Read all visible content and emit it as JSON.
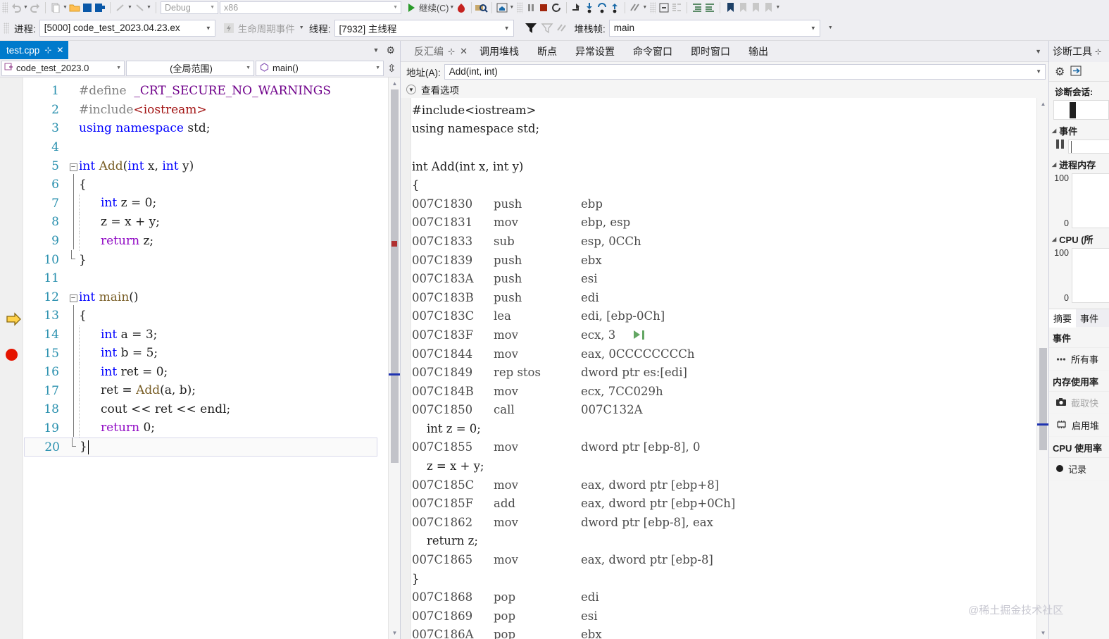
{
  "toolbar": {
    "config_combo": "Debug",
    "platform_combo": "x86",
    "continue_label": "继续(C)",
    "process_label": "进程:",
    "process_value": "[5000] code_test_2023.04.23.ex",
    "lifecycle_label": "生命周期事件",
    "thread_label": "线程:",
    "thread_value": "[7932] 主线程",
    "stackframe_label": "堆栈帧:",
    "stackframe_value": "main"
  },
  "editor": {
    "tab_label": "test.cpp",
    "project_combo": "code_test_2023.0",
    "scope_combo": "(全局范围)",
    "member_combo": "main()",
    "lines": [
      {
        "n": "1",
        "fold": "",
        "guide": false,
        "indent": 0,
        "tokens": [
          {
            "t": "#define",
            "c": "pp"
          },
          {
            "t": "  ",
            "c": "op"
          },
          {
            "t": "_CRT_SECURE_NO_WARNINGS",
            "c": "macro"
          }
        ]
      },
      {
        "n": "2",
        "fold": "",
        "guide": false,
        "indent": 0,
        "tokens": [
          {
            "t": "#include",
            "c": "pp"
          },
          {
            "t": "<iostream>",
            "c": "str"
          }
        ]
      },
      {
        "n": "3",
        "fold": "",
        "guide": false,
        "indent": 0,
        "tokens": [
          {
            "t": "using",
            "c": "kw"
          },
          {
            "t": " ",
            "c": "op"
          },
          {
            "t": "namespace",
            "c": "kw"
          },
          {
            "t": " std;",
            "c": "ident"
          }
        ]
      },
      {
        "n": "4",
        "fold": "",
        "guide": false,
        "indent": 0,
        "tokens": []
      },
      {
        "n": "5",
        "fold": "minus",
        "guide": false,
        "indent": 0,
        "tokens": [
          {
            "t": "int",
            "c": "kw"
          },
          {
            "t": " ",
            "c": "op"
          },
          {
            "t": "Add",
            "c": "fn"
          },
          {
            "t": "(",
            "c": "op"
          },
          {
            "t": "int",
            "c": "kw"
          },
          {
            "t": " x, ",
            "c": "ident"
          },
          {
            "t": "int",
            "c": "kw"
          },
          {
            "t": " y)",
            "c": "ident"
          }
        ]
      },
      {
        "n": "6",
        "fold": "bar",
        "guide": false,
        "indent": 0,
        "tokens": [
          {
            "t": "{",
            "c": "op"
          }
        ]
      },
      {
        "n": "7",
        "fold": "bar",
        "guide": true,
        "indent": 1,
        "tokens": [
          {
            "t": "int",
            "c": "kw"
          },
          {
            "t": " z = ",
            "c": "ident"
          },
          {
            "t": "0",
            "c": "num"
          },
          {
            "t": ";",
            "c": "op"
          }
        ]
      },
      {
        "n": "8",
        "fold": "bar",
        "guide": true,
        "indent": 1,
        "tokens": [
          {
            "t": "z = x + y;",
            "c": "ident"
          }
        ]
      },
      {
        "n": "9",
        "fold": "bar",
        "guide": true,
        "indent": 1,
        "tokens": [
          {
            "t": "return",
            "c": "ctrl"
          },
          {
            "t": " z;",
            "c": "ident"
          }
        ]
      },
      {
        "n": "10",
        "fold": "end",
        "guide": false,
        "indent": 0,
        "tokens": [
          {
            "t": "}",
            "c": "op"
          }
        ]
      },
      {
        "n": "11",
        "fold": "",
        "guide": false,
        "indent": 0,
        "tokens": []
      },
      {
        "n": "12",
        "fold": "minus",
        "guide": false,
        "indent": 0,
        "tokens": [
          {
            "t": "int",
            "c": "kw"
          },
          {
            "t": " ",
            "c": "op"
          },
          {
            "t": "main",
            "c": "fn"
          },
          {
            "t": "()",
            "c": "op"
          }
        ]
      },
      {
        "n": "13",
        "fold": "bar",
        "guide": false,
        "indent": 0,
        "tokens": [
          {
            "t": "{",
            "c": "op"
          }
        ]
      },
      {
        "n": "14",
        "fold": "bar",
        "guide": true,
        "indent": 1,
        "tokens": [
          {
            "t": "int",
            "c": "kw"
          },
          {
            "t": " a = ",
            "c": "ident"
          },
          {
            "t": "3",
            "c": "num"
          },
          {
            "t": ";",
            "c": "op"
          }
        ]
      },
      {
        "n": "15",
        "fold": "bar",
        "guide": true,
        "indent": 1,
        "tokens": [
          {
            "t": "int",
            "c": "kw"
          },
          {
            "t": " b = ",
            "c": "ident"
          },
          {
            "t": "5",
            "c": "num"
          },
          {
            "t": ";",
            "c": "op"
          }
        ]
      },
      {
        "n": "16",
        "fold": "bar",
        "guide": true,
        "indent": 1,
        "tokens": [
          {
            "t": "int",
            "c": "kw"
          },
          {
            "t": " ret = ",
            "c": "ident"
          },
          {
            "t": "0",
            "c": "num"
          },
          {
            "t": ";",
            "c": "op"
          }
        ]
      },
      {
        "n": "17",
        "fold": "bar",
        "guide": true,
        "indent": 1,
        "tokens": [
          {
            "t": "ret = ",
            "c": "ident"
          },
          {
            "t": "Add",
            "c": "fn"
          },
          {
            "t": "(a, b);",
            "c": "ident"
          }
        ]
      },
      {
        "n": "18",
        "fold": "bar",
        "guide": true,
        "indent": 1,
        "tokens": [
          {
            "t": "cout ",
            "c": "ident"
          },
          {
            "t": "<<",
            "c": "op"
          },
          {
            "t": " ret ",
            "c": "ident"
          },
          {
            "t": "<<",
            "c": "op"
          },
          {
            "t": " endl;",
            "c": "ident"
          }
        ]
      },
      {
        "n": "19",
        "fold": "bar",
        "guide": true,
        "indent": 1,
        "tokens": [
          {
            "t": "return",
            "c": "ctrl"
          },
          {
            "t": " ",
            "c": "op"
          },
          {
            "t": "0",
            "c": "num"
          },
          {
            "t": ";",
            "c": "op"
          }
        ]
      },
      {
        "n": "20",
        "fold": "end",
        "guide": false,
        "indent": 0,
        "tokens": [
          {
            "t": "}",
            "c": "op"
          }
        ]
      }
    ],
    "breakpoint_line": 15,
    "instruction_pointer_line": 13
  },
  "disassembly": {
    "tabs": [
      {
        "label": "反汇编",
        "active": true
      },
      {
        "label": "调用堆栈",
        "active": false
      },
      {
        "label": "断点",
        "active": false
      },
      {
        "label": "异常设置",
        "active": false
      },
      {
        "label": "命令窗口",
        "active": false
      },
      {
        "label": "即时窗口",
        "active": false
      },
      {
        "label": "输出",
        "active": false
      }
    ],
    "address_label": "地址(A):",
    "address_value": "Add(int, int)",
    "view_options_label": "查看选项",
    "rows": [
      {
        "type": "src",
        "text": "#include<iostream>"
      },
      {
        "type": "src",
        "text": "using namespace std;"
      },
      {
        "type": "src",
        "text": ""
      },
      {
        "type": "src",
        "text": "int Add(int x, int y)"
      },
      {
        "type": "src",
        "text": "{"
      },
      {
        "type": "asm",
        "addr": "007C1830",
        "mn": "push",
        "ops": "ebp"
      },
      {
        "type": "asm",
        "addr": "007C1831",
        "mn": "mov",
        "ops": "ebp, esp"
      },
      {
        "type": "asm",
        "addr": "007C1833",
        "mn": "sub",
        "ops": "esp, 0CCh"
      },
      {
        "type": "asm",
        "addr": "007C1839",
        "mn": "push",
        "ops": "ebx"
      },
      {
        "type": "asm",
        "addr": "007C183A",
        "mn": "push",
        "ops": "esi"
      },
      {
        "type": "asm",
        "addr": "007C183B",
        "mn": "push",
        "ops": "edi"
      },
      {
        "type": "asm",
        "addr": "007C183C",
        "mn": "lea",
        "ops": "edi, [ebp-0Ch]"
      },
      {
        "type": "asm",
        "addr": "007C183F",
        "mn": "mov",
        "ops": "ecx, 3",
        "marker": true
      },
      {
        "type": "asm",
        "addr": "007C1844",
        "mn": "mov",
        "ops": "eax, 0CCCCCCCCh"
      },
      {
        "type": "asm",
        "addr": "007C1849",
        "mn": "rep stos",
        "ops": "dword ptr es:[edi]"
      },
      {
        "type": "asm",
        "addr": "007C184B",
        "mn": "mov",
        "ops": "ecx, 7CC029h"
      },
      {
        "type": "asm",
        "addr": "007C1850",
        "mn": "call",
        "ops": "007C132A"
      },
      {
        "type": "src",
        "text": "    int z = 0;"
      },
      {
        "type": "asm",
        "addr": "007C1855",
        "mn": "mov",
        "ops": "dword ptr [ebp-8], 0"
      },
      {
        "type": "src",
        "text": "    z = x + y;"
      },
      {
        "type": "asm",
        "addr": "007C185C",
        "mn": "mov",
        "ops": "eax, dword ptr [ebp+8]"
      },
      {
        "type": "asm",
        "addr": "007C185F",
        "mn": "add",
        "ops": "eax, dword ptr [ebp+0Ch]"
      },
      {
        "type": "asm",
        "addr": "007C1862",
        "mn": "mov",
        "ops": "dword ptr [ebp-8], eax"
      },
      {
        "type": "src",
        "text": "    return z;"
      },
      {
        "type": "asm",
        "addr": "007C1865",
        "mn": "mov",
        "ops": "eax, dword ptr [ebp-8]"
      },
      {
        "type": "src",
        "text": "}"
      },
      {
        "type": "asm",
        "addr": "007C1868",
        "mn": "pop",
        "ops": "edi"
      },
      {
        "type": "asm",
        "addr": "007C1869",
        "mn": "pop",
        "ops": "esi"
      },
      {
        "type": "asm",
        "addr": "007C186A",
        "mn": "pop",
        "ops": "ebx"
      }
    ]
  },
  "diagnostics": {
    "tab_label": "诊断工具",
    "session_label": "诊断会话:",
    "events_section": "事件",
    "memory_section": "进程内存",
    "cpu_section": "CPU (所",
    "memory_axis_max": "100",
    "memory_axis_min": "0",
    "cpu_axis_max": "100",
    "cpu_axis_min": "0",
    "lower_tabs": [
      {
        "label": "摘要",
        "active": true
      },
      {
        "label": "事件",
        "active": false
      }
    ],
    "sections": [
      {
        "head": "事件",
        "item": "所有事",
        "icon": "ellipsis-icon",
        "dim": false
      },
      {
        "head": "内存使用率",
        "item": "截取快",
        "icon": "camera-icon",
        "dim": true
      },
      {
        "head": "",
        "item": "启用堆",
        "icon": "memory-chip-icon",
        "dim": false
      },
      {
        "head": "CPU 使用率",
        "item": "记录",
        "icon": "record-dot-icon",
        "dim": false
      }
    ]
  },
  "watermark": "@稀土掘金技术社区"
}
